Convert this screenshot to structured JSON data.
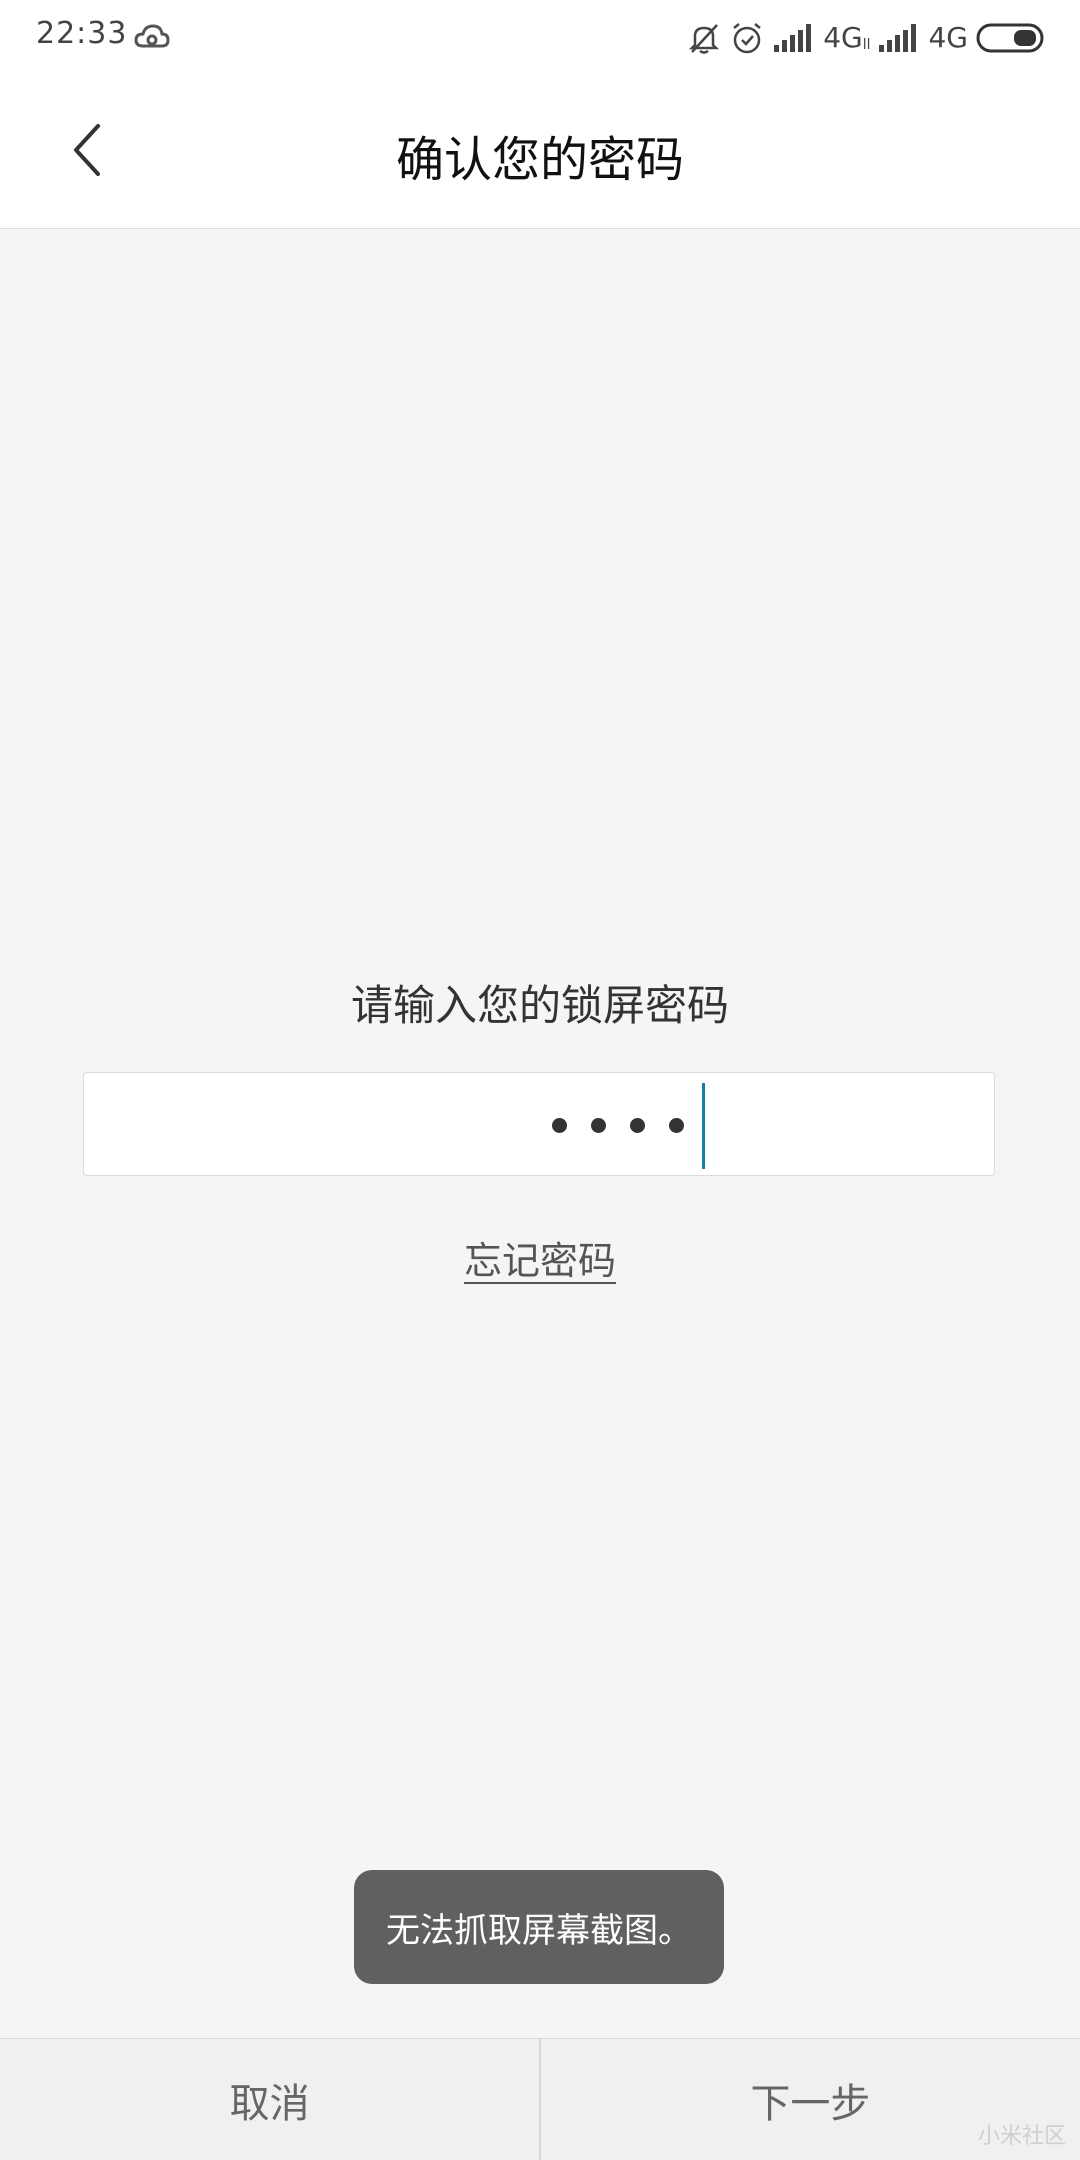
{
  "status_bar": {
    "time": "22:33",
    "net1": "4G",
    "net1_sub": "ll",
    "net2": "4G",
    "icons": [
      "cloud-icon",
      "bell-off-icon",
      "alarm-icon",
      "signal-icon",
      "battery-icon"
    ]
  },
  "header": {
    "title": "确认您的密码",
    "back_icon": "chevron-left-icon"
  },
  "main": {
    "prompt": "请输入您的锁屏密码",
    "password_masked_count": 4,
    "forgot_link": "忘记密码"
  },
  "toast": {
    "message": "无法抓取屏幕截图。"
  },
  "bottom_bar": {
    "cancel_label": "取消",
    "next_label": "下一步"
  },
  "watermark": "小米社区",
  "colors": {
    "accent_cursor": "#1a7fa6",
    "toast_bg": "#606060",
    "background": "#f5f5f5"
  }
}
